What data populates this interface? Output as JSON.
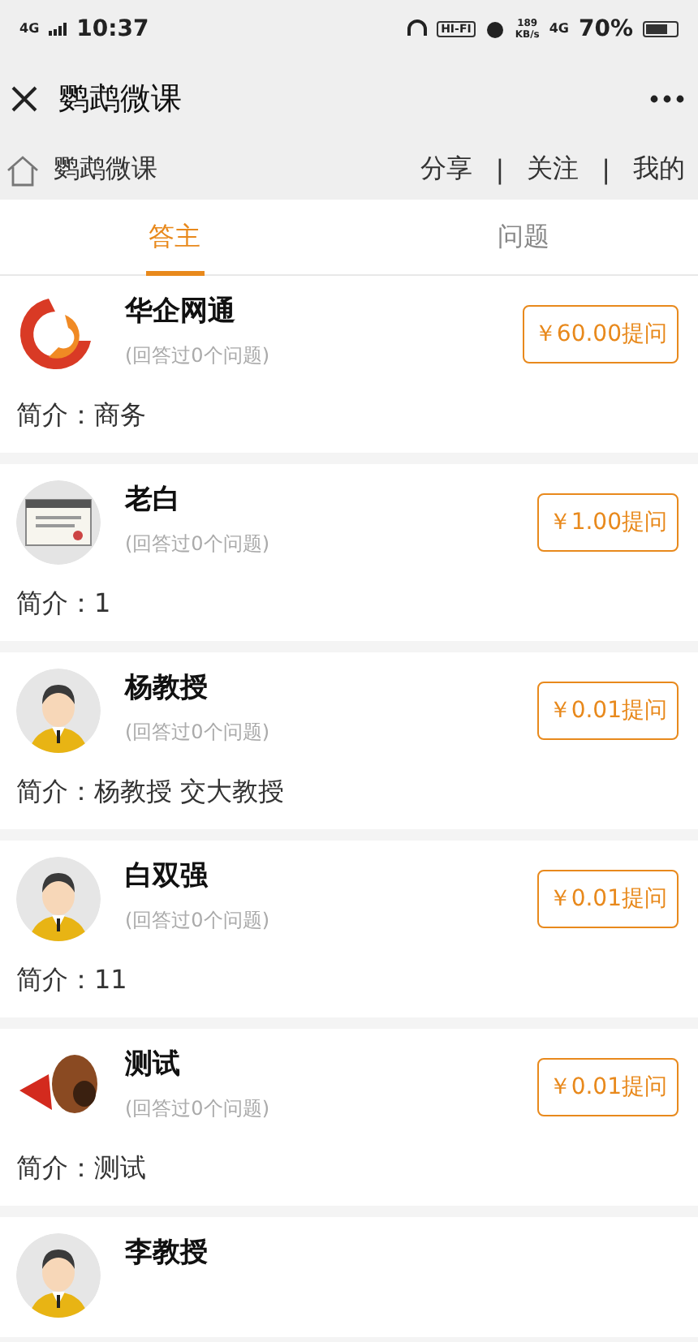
{
  "status_bar": {
    "network": "4G",
    "time": "10:37",
    "hifi": "HI-FI",
    "speed": "189",
    "speed_unit": "KB/s",
    "network_right": "4G",
    "battery": "70%"
  },
  "title_bar": {
    "title": "鹦鹉微课"
  },
  "nav": {
    "home_label": "鹦鹉微课",
    "items": [
      {
        "kind": "link",
        "text": "分享"
      },
      {
        "kind": "separator",
        "text": "|"
      },
      {
        "kind": "link",
        "text": "关注"
      },
      {
        "kind": "separator",
        "text": "|"
      },
      {
        "kind": "link",
        "text": "我的"
      }
    ]
  },
  "tabs": [
    {
      "label": "答主",
      "selected": true
    },
    {
      "label": "问题",
      "selected": false
    }
  ],
  "experts": [
    {
      "kind": "logo",
      "name": "华企网通",
      "answered": "(回答过0个问题)",
      "price": "￥60.00提问",
      "intro": "简介：商务"
    },
    {
      "kind": "document",
      "name": "老白",
      "answered": "(回答过0个问题)",
      "price": "￥1.00提问",
      "intro": "简介：1"
    },
    {
      "kind": "person",
      "name": "杨教授",
      "answered": "(回答过0个问题)",
      "price": "￥0.01提问",
      "intro": "简介：杨教授 交大教授"
    },
    {
      "kind": "person",
      "name": "白双强",
      "answered": "(回答过0个问题)",
      "price": "￥0.01提问",
      "intro": "简介：11"
    },
    {
      "kind": "dog",
      "name": "测试",
      "answered": "(回答过0个问题)",
      "price": "￥0.01提问",
      "intro": "简介：测试"
    },
    {
      "kind": "person",
      "name": "李教授"
    }
  ]
}
